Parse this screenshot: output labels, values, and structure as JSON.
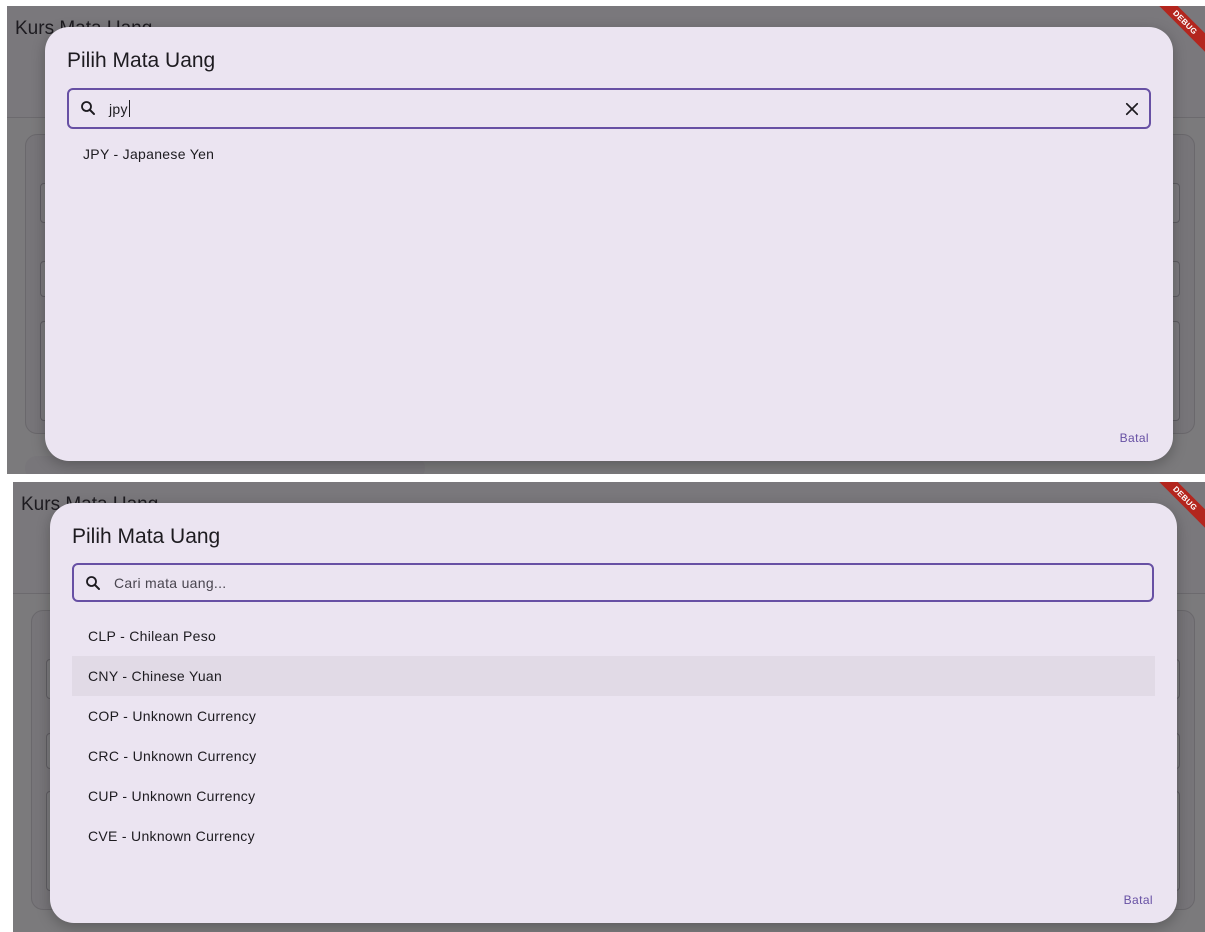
{
  "screens": [
    {
      "background_title": "Kurs Mata Uang",
      "debug_label": "DEBUG",
      "dialog": {
        "title": "Pilih Mata Uang",
        "search": {
          "value": "jpy",
          "placeholder": ""
        },
        "items": [
          "JPY - Japanese Yen"
        ],
        "cancel_label": "Batal"
      }
    },
    {
      "background_title": "Kurs Mata Uang",
      "debug_label": "DEBUG",
      "dialog": {
        "title": "Pilih Mata Uang",
        "search": {
          "value": "",
          "placeholder": "Cari mata uang..."
        },
        "items": [
          "CLP - Chilean Peso",
          "CNY - Chinese Yuan",
          "COP - Unknown Currency",
          "CRC - Unknown Currency",
          "CUP - Unknown Currency",
          "CVE - Unknown Currency"
        ],
        "hovered_item": "CNY - Chinese Yuan",
        "cancel_label": "Batal"
      }
    }
  ],
  "colors": {
    "accent": "#6750a4",
    "dialog_surface": "#ebe4f1",
    "scrim": "#7b7a7c",
    "debug_ribbon": "#b3261e"
  },
  "icons": [
    "search-icon",
    "close-icon"
  ]
}
